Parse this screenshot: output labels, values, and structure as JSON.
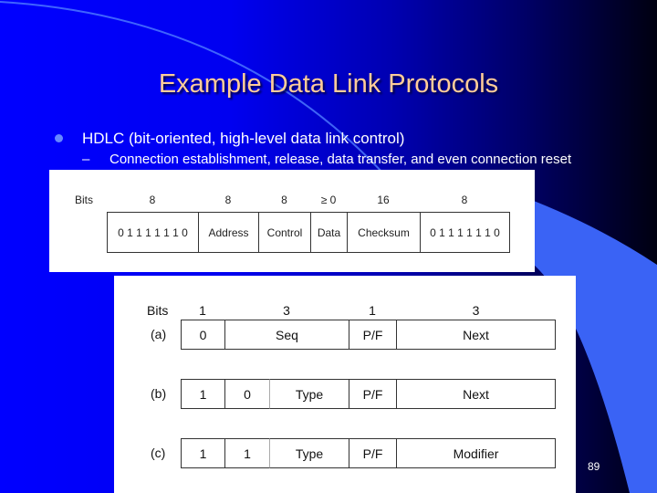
{
  "slide": {
    "title": "Example Data Link Protocols",
    "bullet": "HDLC (bit-oriented, high-level data link control)",
    "sub_bullet_marker": "–",
    "sub_bullet": "Connection establishment, release, data transfer, and even connection reset",
    "page_number": "89",
    "colors": {
      "title": "#ffcc99",
      "background_left": "#0000ff",
      "background_right": "#000010",
      "accent_band": "#3366ff"
    }
  },
  "frame_diagram": {
    "bits_label": "Bits",
    "bit_sizes": [
      "8",
      "8",
      "8",
      "≥ 0",
      "16",
      "8"
    ],
    "fields": [
      "0 1 1 1 1 1 1 0",
      "Address",
      "Control",
      "Data",
      "Checksum",
      "0 1 1 1 1 1 1 0"
    ]
  },
  "control_diagram": {
    "bits_label": "Bits",
    "bit_sizes": [
      "1",
      "3",
      "1",
      "3"
    ],
    "rows": [
      {
        "label": "(a)",
        "fields": [
          "0",
          "Seq",
          "P/F",
          "Next"
        ]
      },
      {
        "label": "(b)",
        "fields": [
          "1",
          "0",
          "Type",
          "P/F",
          "Next"
        ]
      },
      {
        "label": "(c)",
        "fields": [
          "1",
          "1",
          "Type",
          "P/F",
          "Modifier"
        ]
      }
    ]
  }
}
